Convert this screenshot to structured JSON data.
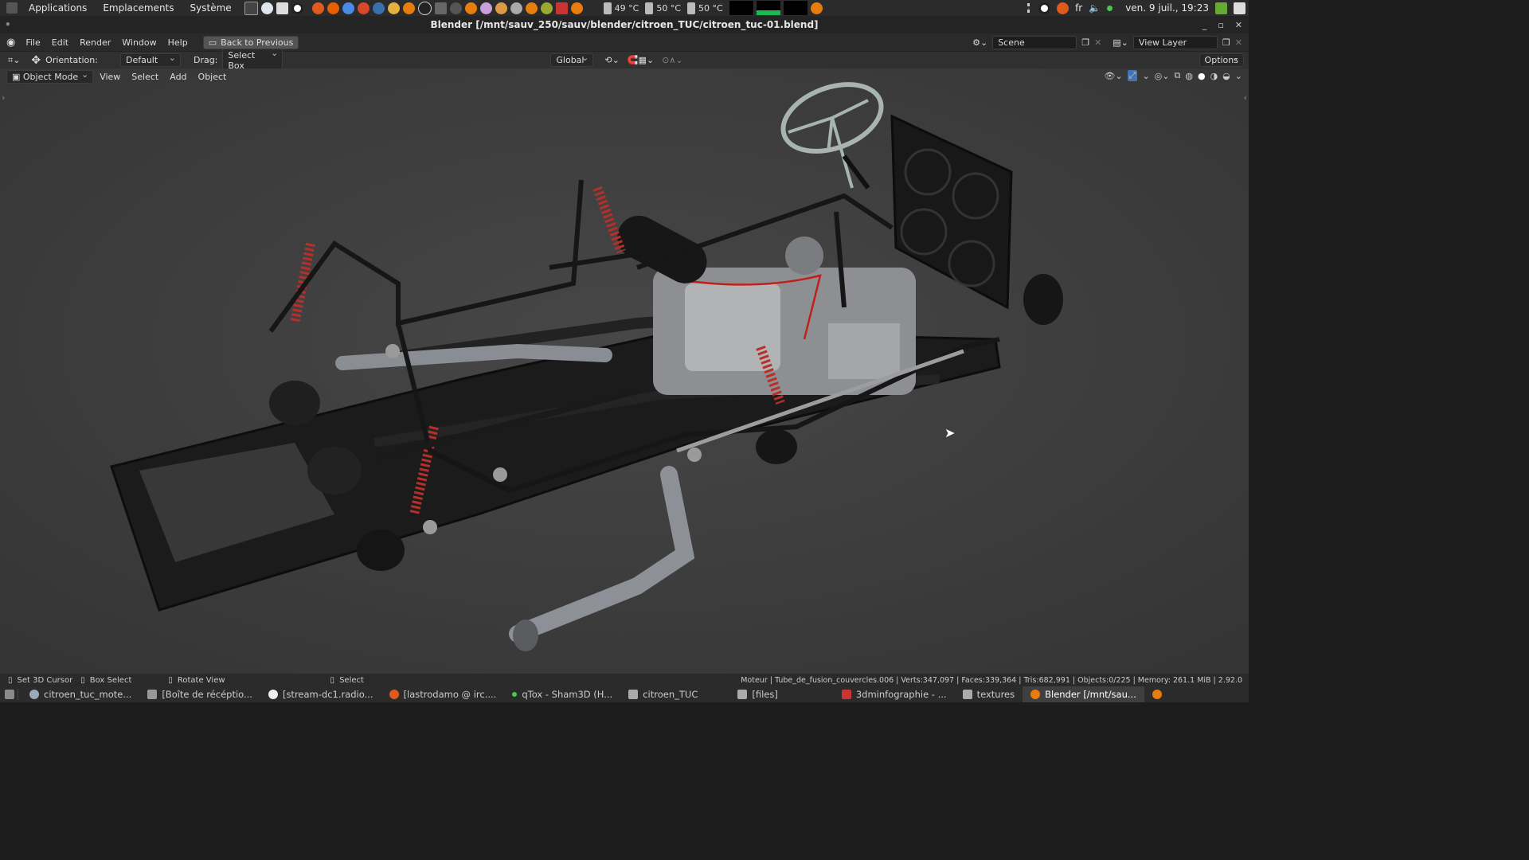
{
  "system_bar": {
    "menus": [
      "Applications",
      "Emplacements",
      "Système"
    ],
    "temps": [
      "49 °C",
      "50 °C",
      "50 °C"
    ],
    "lang": "fr",
    "clock": "ven. 9 juil., 19:23"
  },
  "window": {
    "title": "Blender [/mnt/sauv_250/sauv/blender/citroen_TUC/citroen_tuc-01.blend]"
  },
  "menubar": {
    "items": [
      "File",
      "Edit",
      "Render",
      "Window",
      "Help"
    ],
    "back_button": "Back to Previous",
    "scene": "Scene",
    "view_layer": "View Layer"
  },
  "toolbar": {
    "orientation_label": "Orientation:",
    "orientation_value": "Default",
    "drag_label": "Drag:",
    "drag_value": "Select Box",
    "transform_value": "Global",
    "options_label": "Options"
  },
  "viewport_header": {
    "mode": "Object Mode",
    "menus": [
      "View",
      "Select",
      "Add",
      "Object"
    ]
  },
  "statusbar": {
    "hints": [
      "Set 3D Cursor",
      "Box Select",
      "Rotate View",
      "Select"
    ],
    "stats": "Moteur | Tube_de_fusion_couvercles.006 | Verts:347,097 | Faces:339,364 | Tris:682,991 | Objects:0/225 | Memory: 261.1 MiB | 2.92.0"
  },
  "taskbar": {
    "tasks": [
      {
        "label": "citroen_tuc_mote...",
        "active": false
      },
      {
        "label": "[Boîte de récéptio...",
        "active": false
      },
      {
        "label": "[stream-dc1.radio...",
        "active": false
      },
      {
        "label": "[lastrodamo @ irc....",
        "active": false
      },
      {
        "label": "qTox - Sham3D (H...",
        "active": false
      },
      {
        "label": "citroen_TUC",
        "active": false
      },
      {
        "label": "[files]",
        "active": false
      },
      {
        "label": "3dminfographie - ...",
        "active": false
      },
      {
        "label": "textures",
        "active": false
      },
      {
        "label": "Blender [/mnt/sau...",
        "active": true
      }
    ]
  },
  "colors": {
    "accent": "#4772b3",
    "viewport_bg": "#3a3a3a",
    "spring_red": "#b5302a"
  }
}
